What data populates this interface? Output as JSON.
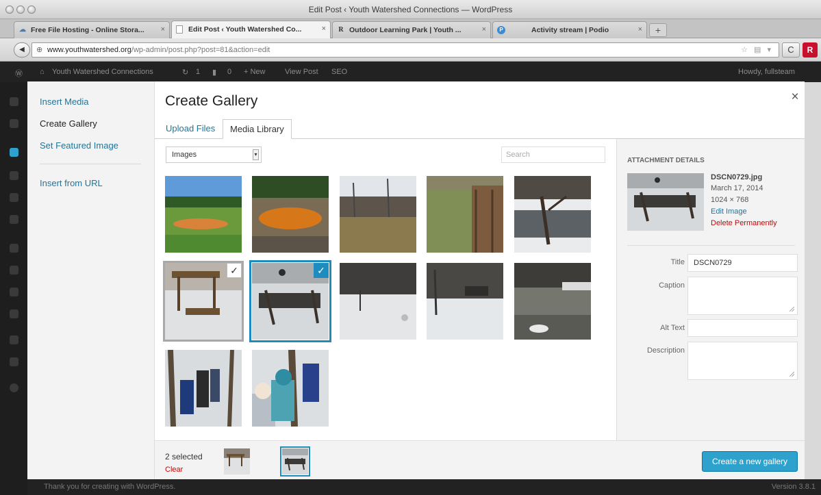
{
  "window": {
    "title": "Edit Post ‹ Youth Watershed Connections — WordPress"
  },
  "browser": {
    "tabs": [
      {
        "label": "Free File Hosting - Online Stora...",
        "icon": "cloud-icon",
        "close": "×"
      },
      {
        "label": "Edit Post ‹ Youth Watershed Co...",
        "icon": "page-icon",
        "close": "×"
      },
      {
        "label": "Outdoor Learning Park | Youth ...",
        "icon": "r-logo-icon",
        "close": "×"
      },
      {
        "label": "Activity stream | Podio",
        "icon": "podio-icon",
        "close": "×"
      }
    ],
    "new_tab": "+",
    "back": "◀",
    "url_domain": "www.youthwatershed.org",
    "url_path": "/wp-admin/post.php?post=81&action=edit",
    "url_icons": "☆ ▤ ▾",
    "reload": "C",
    "extension": "R"
  },
  "wp_admin_bar": {
    "site_name": "Youth Watershed Connections",
    "updates_count": "1",
    "comments_count": "0",
    "new_label": "+ New",
    "view_post": "View Post",
    "seo": "SEO",
    "greeting": "Howdy, fullsteam"
  },
  "wp_footer": {
    "left": "Thank you for creating with WordPress.",
    "right": "Version 3.8.1"
  },
  "media_modal": {
    "menu": {
      "insert_media": "Insert Media",
      "create_gallery": "Create Gallery",
      "set_featured_image": "Set Featured Image",
      "insert_from_url": "Insert from URL"
    },
    "title": "Create Gallery",
    "close": "×",
    "tabs": {
      "upload_files": "Upload Files",
      "media_library": "Media Library"
    },
    "filter": {
      "selected": "Images",
      "arrow": "▾"
    },
    "search_placeholder": "Search",
    "check_mark": "✓",
    "attachment_details": {
      "heading": "ATTACHMENT DETAILS",
      "filename": "DSCN0729.jpg",
      "date": "March 17, 2014",
      "dimensions": "1024 × 768",
      "edit_image": "Edit Image",
      "delete_permanently": "Delete Permanently",
      "title_label": "Title",
      "title_value": "DSCN0729",
      "caption_label": "Caption",
      "alt_text_label": "Alt Text",
      "description_label": "Description"
    },
    "toolbar": {
      "selected_count": "2 selected",
      "clear": "Clear",
      "create_button": "Create a new gallery"
    }
  }
}
